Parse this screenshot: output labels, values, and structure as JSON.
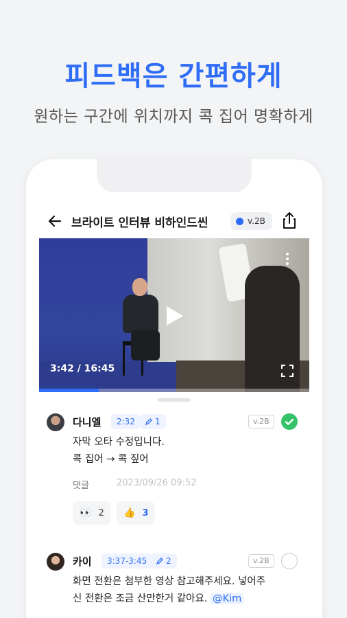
{
  "headline": "피드백은 간편하게",
  "subheadline": "원하는 구간에 위치까지 콕 집어 명확하게",
  "app": {
    "title": "브라이트 인터뷰 비하인드씬",
    "version": "v.2B"
  },
  "video": {
    "time": "3:42 / 16:45",
    "progress": 0.22
  },
  "comments": [
    {
      "author": "다니엘",
      "timestamp": "2:32",
      "draw_count": "1",
      "version": "v.2B",
      "resolved": true,
      "lines": [
        "자막 오타 수정입니다.",
        "콕 집어 → 콕 짚어"
      ],
      "reply_label": "댓글",
      "date": "2023/09/26 09:52",
      "reactions": [
        {
          "emoji": "👀",
          "count": "2",
          "active": false
        },
        {
          "emoji": "👍",
          "count": "3",
          "active": true
        }
      ]
    },
    {
      "author": "카이",
      "timestamp": "3:37-3:45",
      "draw_count": "2",
      "version": "v.2B",
      "resolved": false,
      "line1": "화면 전환은 첨부한 영상 참고해주세요. 넣어주",
      "line2": "신 전환은 조금 산만한거 같아요.",
      "mention": "@Kim"
    }
  ]
}
